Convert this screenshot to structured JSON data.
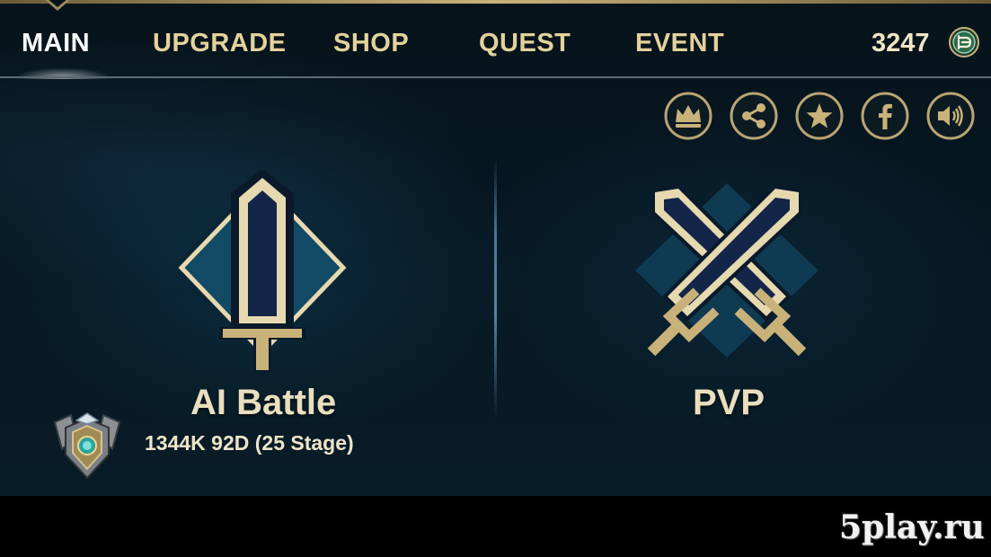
{
  "nav": {
    "tabs": [
      {
        "label": "MAIN",
        "active": true
      },
      {
        "label": "UPGRADE",
        "active": false
      },
      {
        "label": "SHOP",
        "active": false
      },
      {
        "label": "QUEST",
        "active": false
      },
      {
        "label": "EVENT",
        "active": false
      }
    ]
  },
  "currency": {
    "amount": "3247",
    "icon": "coin-icon"
  },
  "social_buttons": [
    {
      "icon": "crown-icon"
    },
    {
      "icon": "share-icon"
    },
    {
      "icon": "star-icon"
    },
    {
      "icon": "facebook-icon"
    },
    {
      "icon": "speaker-icon"
    }
  ],
  "modes": {
    "ai_battle": {
      "title": "AI Battle",
      "icon": "sword-icon"
    },
    "pvp": {
      "title": "PVP",
      "icon": "crossed-swords-icon"
    }
  },
  "rank": {
    "text": "1344K 92D (25 Stage)",
    "icon": "rank-badge-icon"
  },
  "watermark": {
    "text": "5play.ru"
  },
  "colors": {
    "gold": "#c9b27a",
    "navy": "#14254a",
    "text_gold": "#e3d29c",
    "background": "#061722"
  }
}
